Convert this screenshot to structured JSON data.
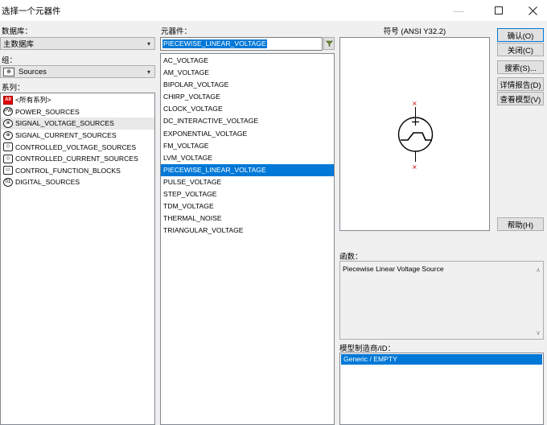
{
  "window": {
    "title": "选择一个元器件",
    "minimize_icon": "minimize-icon",
    "maximize_icon": "maximize-icon",
    "close_icon": "close-icon"
  },
  "database": {
    "label": "数据库：",
    "selected": "主数据库"
  },
  "group": {
    "label": "组：",
    "selected": "Sources",
    "icon": "sources-group-icon"
  },
  "family": {
    "label": "系列：",
    "items": [
      {
        "icon_text": "All",
        "icon": "all-families-icon",
        "label": "<所有系列>"
      },
      {
        "icon_text": "PW",
        "icon": "power-sources-icon",
        "label": "POWER_SOURCES"
      },
      {
        "icon_text": "⊕",
        "icon": "signal-voltage-icon",
        "label": "SIGNAL_VOLTAGE_SOURCES"
      },
      {
        "icon_text": "⊕",
        "icon": "signal-current-icon",
        "label": "SIGNAL_CURRENT_SOURCES"
      },
      {
        "icon_text": "◇",
        "icon": "controlled-voltage-icon",
        "label": "CONTROLLED_VOLTAGE_SOURCES"
      },
      {
        "icon_text": "◇",
        "icon": "controlled-current-icon",
        "label": "CONTROLLED_CURRENT_SOURCES"
      },
      {
        "icon_text": "▭",
        "icon": "control-function-icon",
        "label": "CONTROL_FUNCTION_BLOCKS"
      },
      {
        "icon_text": "01",
        "icon": "digital-sources-icon",
        "label": "DIGITAL_SOURCES"
      }
    ]
  },
  "component": {
    "label": "元器件：",
    "input_value": "PIECEWISE_LINEAR_VOLTAGE",
    "filter_icon": "filter-icon",
    "selected_index": 10,
    "items": [
      "AC_VOLTAGE",
      "AM_VOLTAGE",
      "BIPOLAR_VOLTAGE",
      "CHIRP_VOLTAGE",
      "CLOCK_VOLTAGE",
      "DC_INTERACTIVE_VOLTAGE",
      "EXPONENTIAL_VOLTAGE",
      "FM_VOLTAGE",
      "LVM_VOLTAGE",
      "PIECEWISE_LINEAR_VOLTAGE",
      "PULSE_VOLTAGE",
      "STEP_VOLTAGE",
      "TDM_VOLTAGE",
      "THERMAL_NOISE",
      "TRIANGULAR_VOLTAGE"
    ]
  },
  "symbol": {
    "label": "符号 (ANSI Y32.2)",
    "icon": "pwl-voltage-source-symbol"
  },
  "function": {
    "label": "函数：",
    "text": "Piecewise Linear Voltage Source"
  },
  "model": {
    "label": "模型制造商/ID：",
    "items": [
      "Generic / EMPTY"
    ]
  },
  "buttons": {
    "ok": "确认(O)",
    "close": "关闭(C)",
    "search": "搜索(S)...",
    "detail_report": "详情报告(D)",
    "view_model": "查看模型(V)",
    "help": "帮助(H)"
  },
  "colors": {
    "selection": "#0078d7",
    "symbol_red": "#d00000",
    "all_badge": "#e00000"
  }
}
